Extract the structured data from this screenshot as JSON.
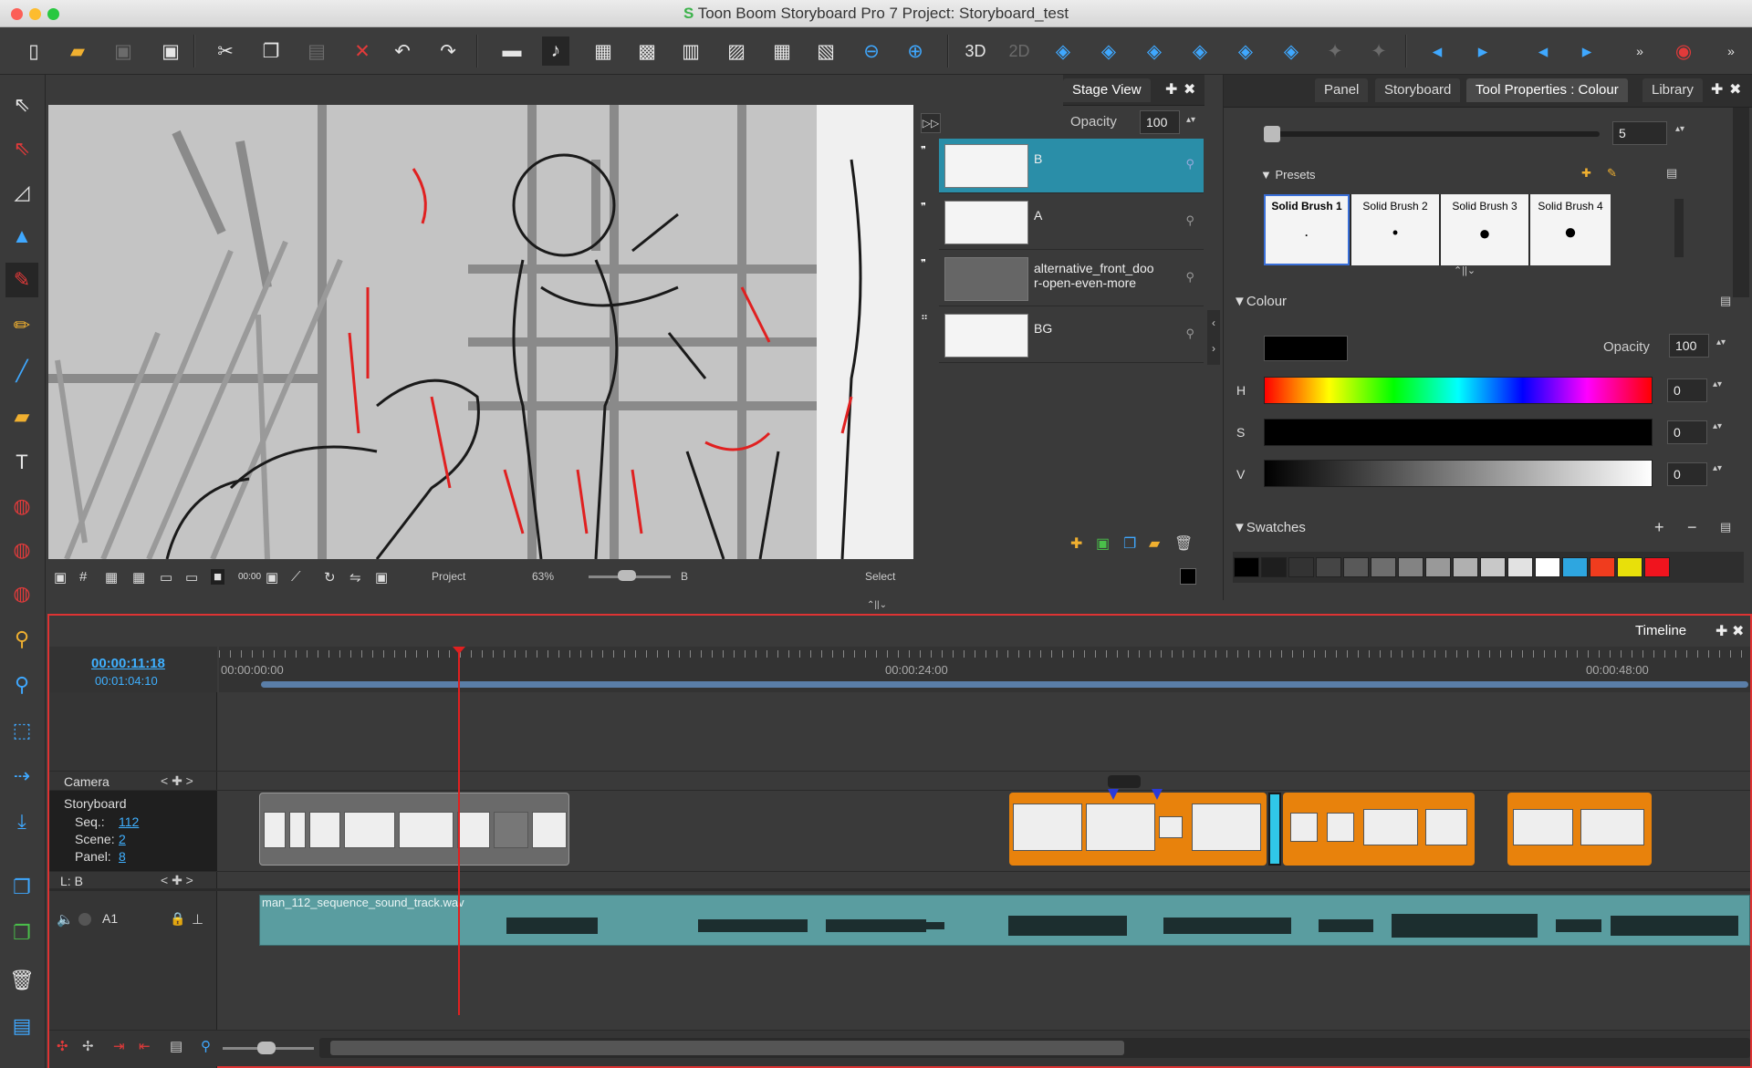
{
  "window": {
    "title": "Toon Boom Storyboard Pro 7 Project:  Storyboard_test"
  },
  "stage_view": {
    "tab": "Stage View",
    "opacity_label": "Opacity",
    "opacity_value": "100",
    "layers": [
      {
        "name": "B",
        "selected": true
      },
      {
        "name": "A",
        "selected": false
      },
      {
        "name": "alternative_front_door-open-even-more",
        "line1": "alternative_front_doo",
        "line2": "r-open-even-more",
        "selected": false
      },
      {
        "name": "BG",
        "selected": false
      }
    ],
    "statusbar": {
      "view_mode": "Project",
      "zoom": "63%",
      "layer": "B",
      "tool": "Select"
    }
  },
  "tool_properties": {
    "tabs": [
      "Panel",
      "Storyboard",
      "Tool Properties : Colour",
      "Library"
    ],
    "active_tab": "Tool Properties : Colour",
    "size_value": "5",
    "presets_label": "Presets",
    "presets": [
      "Solid Brush 1",
      "Solid Brush 2",
      "Solid Brush 3",
      "Solid Brush 4"
    ],
    "colour_label": "Colour",
    "opacity_label": "Opacity",
    "opacity_value": "100",
    "h_label": "H",
    "h_value": "0",
    "s_label": "S",
    "s_value": "0",
    "v_label": "V",
    "v_value": "0",
    "swatches_label": "Swatches",
    "swatches": [
      "#000000",
      "#1e1e1e",
      "#333333",
      "#454545",
      "#595959",
      "#6e6e6e",
      "#838383",
      "#999999",
      "#b0b0b0",
      "#c8c8c8",
      "#e2e2e2",
      "#ffffff",
      "#2ea6e0",
      "#f03c1e",
      "#e8e00a",
      "#f0141e"
    ]
  },
  "timeline": {
    "tab": "Timeline",
    "current_time": "00:00:11:18",
    "sub_time": "00:01:04:10",
    "ruler": [
      "00:00:00:00",
      "00:00:24:00",
      "00:00:48:00"
    ],
    "camera_label": "Camera",
    "storyboard_label": "Storyboard",
    "seq_label": "Seq.:",
    "seq_value": "112",
    "scene_label": "Scene:",
    "scene_value": "2",
    "panel_label": "Panel:",
    "panel_value": "8",
    "layer_label": "L: B",
    "audio_track": "A1",
    "audio_file": "man_112_sequence_sound_track.wav"
  },
  "colors": {
    "accent": "#2a8ea8",
    "timeline_border": "#dd3333",
    "clip_orange": "#e8820c",
    "playhead": "#e02020"
  }
}
